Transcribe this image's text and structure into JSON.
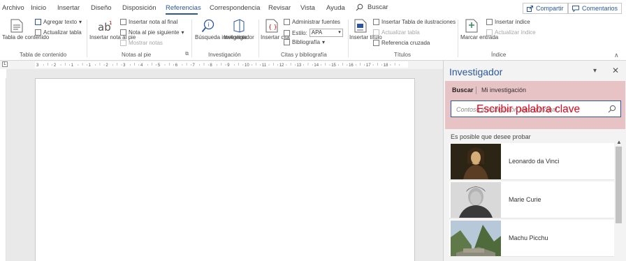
{
  "menu": {
    "tabs": [
      {
        "label": "Archivo"
      },
      {
        "label": "Inicio"
      },
      {
        "label": "Insertar"
      },
      {
        "label": "Diseño"
      },
      {
        "label": "Disposición"
      },
      {
        "label": "Referencias"
      },
      {
        "label": "Correspondencia"
      },
      {
        "label": "Revisar"
      },
      {
        "label": "Vista"
      },
      {
        "label": "Ayuda"
      }
    ],
    "active_tab": "Referencias",
    "search_label": "Buscar",
    "share_label": "Compartir",
    "comments_label": "Comentarios"
  },
  "ribbon": {
    "toc": {
      "big_button": "Tabla de contenido",
      "add_text": "Agregar texto",
      "update_table": "Actualizar tabla",
      "group_name": "Tabla de contenido"
    },
    "footnotes": {
      "big_button": "Insertar nota al pie",
      "insert_endnote": "Insertar nota al final",
      "next_footnote": "Nota al pie siguiente",
      "show_notes": "Mostrar notas",
      "group_name": "Notas al pie"
    },
    "research": {
      "smart_lookup": "Búsqueda inteligente",
      "researcher": "Investigador",
      "group_name": "Investigación"
    },
    "citations": {
      "insert_citation": "Insertar cita",
      "manage_sources": "Administrar fuentes",
      "style_label": "Estilo:",
      "style_value": "APA",
      "bibliography": "Bibliografía",
      "group_name": "Citas y bibliografía"
    },
    "captions": {
      "insert_caption": "Insertar título",
      "insert_table_of_figures": "Insertar Tabla de ilustraciones",
      "update_table": "Actualizar tabla",
      "cross_reference": "Referencia cruzada",
      "group_name": "Títulos"
    },
    "index": {
      "mark_entry": "Marcar entrada",
      "insert_index": "Insertar índice",
      "update_index": "Actualizar índice",
      "group_name": "Índice"
    }
  },
  "ruler": {
    "numbers": [
      "3",
      "2",
      "1",
      "1",
      "2",
      "3",
      "4",
      "5",
      "6",
      "7",
      "8",
      "9",
      "10",
      "11",
      "12",
      "13",
      "14",
      "15",
      "16",
      "17",
      "18"
    ]
  },
  "pane": {
    "title": "Investigador",
    "tab_search": "Buscar",
    "tab_my_research": "Mi investigación",
    "search_placeholder": "Contoso investigación topo principal",
    "overlay_label": "Escribir palabra clave",
    "suggestion_heading": "Es posible que desee probar",
    "results": [
      {
        "name": "Leonardo da Vinci"
      },
      {
        "name": "Marie Curie"
      },
      {
        "name": "Machu Picchu"
      }
    ]
  },
  "colors": {
    "accent": "#2b579a",
    "highlight_zone": "#e8c3c6",
    "overlay_text": "#e2041b"
  }
}
